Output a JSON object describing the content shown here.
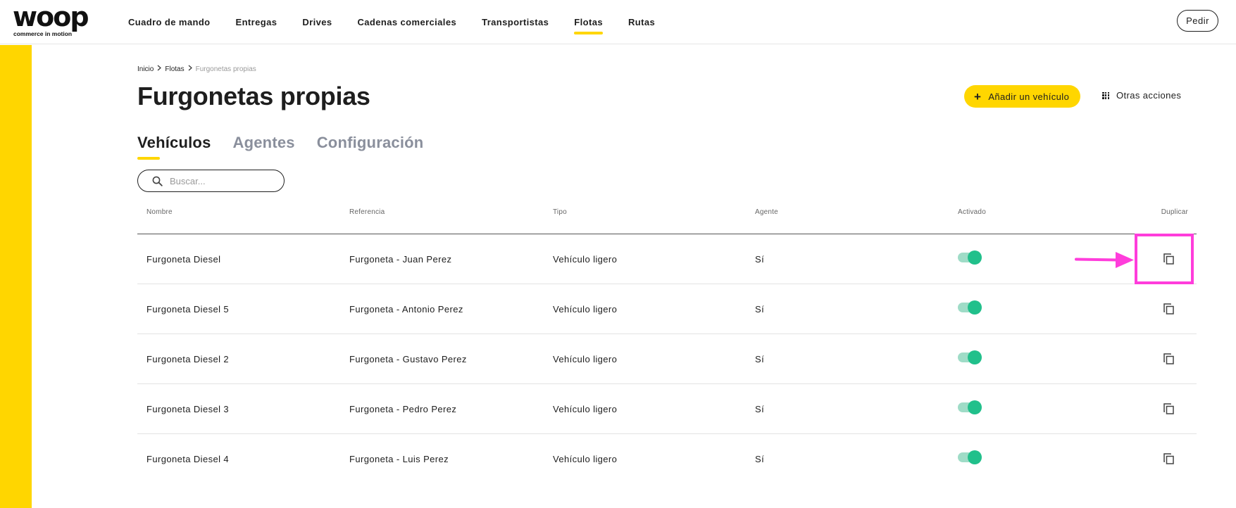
{
  "brand": {
    "name": "woop",
    "tagline": "commerce in motion",
    "accent_color": "#ffd600"
  },
  "nav": {
    "items": [
      {
        "label": "Cuadro de mando",
        "active": false
      },
      {
        "label": "Entregas",
        "active": false
      },
      {
        "label": "Drives",
        "active": false
      },
      {
        "label": "Cadenas comerciales",
        "active": false
      },
      {
        "label": "Transportistas",
        "active": false
      },
      {
        "label": "Flotas",
        "active": true
      },
      {
        "label": "Rutas",
        "active": false
      }
    ],
    "order_button_label": "Pedir"
  },
  "breadcrumb": {
    "items": [
      "Inicio",
      "Flotas"
    ],
    "current": "Furgonetas propias"
  },
  "page": {
    "title": "Furgonetas propias",
    "add_button_label": "Añadir un vehículo",
    "more_actions_label": "Otras acciones"
  },
  "tabs": [
    {
      "label": "Vehículos",
      "active": true
    },
    {
      "label": "Agentes",
      "active": false
    },
    {
      "label": "Configuración",
      "active": false
    }
  ],
  "search": {
    "placeholder": "Buscar...",
    "value": ""
  },
  "table": {
    "columns": [
      "Nombre",
      "Referencia",
      "Tipo",
      "Agente",
      "Activado",
      "Duplicar"
    ],
    "rows": [
      {
        "name": "Furgoneta Diesel",
        "reference": "Furgoneta - Juan Perez",
        "type": "Vehículo ligero",
        "agent": "Sí",
        "activated": true
      },
      {
        "name": "Furgoneta Diesel 5",
        "reference": "Furgoneta - Antonio Perez",
        "type": "Vehículo ligero",
        "agent": "Sí",
        "activated": true
      },
      {
        "name": "Furgoneta Diesel 2",
        "reference": "Furgoneta - Gustavo Perez",
        "type": "Vehículo ligero",
        "agent": "Sí",
        "activated": true
      },
      {
        "name": "Furgoneta Diesel 3",
        "reference": "Furgoneta - Pedro Perez",
        "type": "Vehículo ligero",
        "agent": "Sí",
        "activated": true
      },
      {
        "name": "Furgoneta Diesel 4",
        "reference": "Furgoneta - Luis Perez",
        "type": "Vehículo ligero",
        "agent": "Sí",
        "activated": true
      }
    ]
  },
  "colors": {
    "toggle_on_track": "#9fdcc7",
    "toggle_on_knob": "#21c08b",
    "annotation": "#ff3ddb"
  },
  "icons": {
    "search": "search-icon",
    "add": "plus-icon",
    "more_actions": "grid-icon",
    "duplicate": "copy-icon",
    "breadcrumb_separator": "chevron-right-icon"
  }
}
